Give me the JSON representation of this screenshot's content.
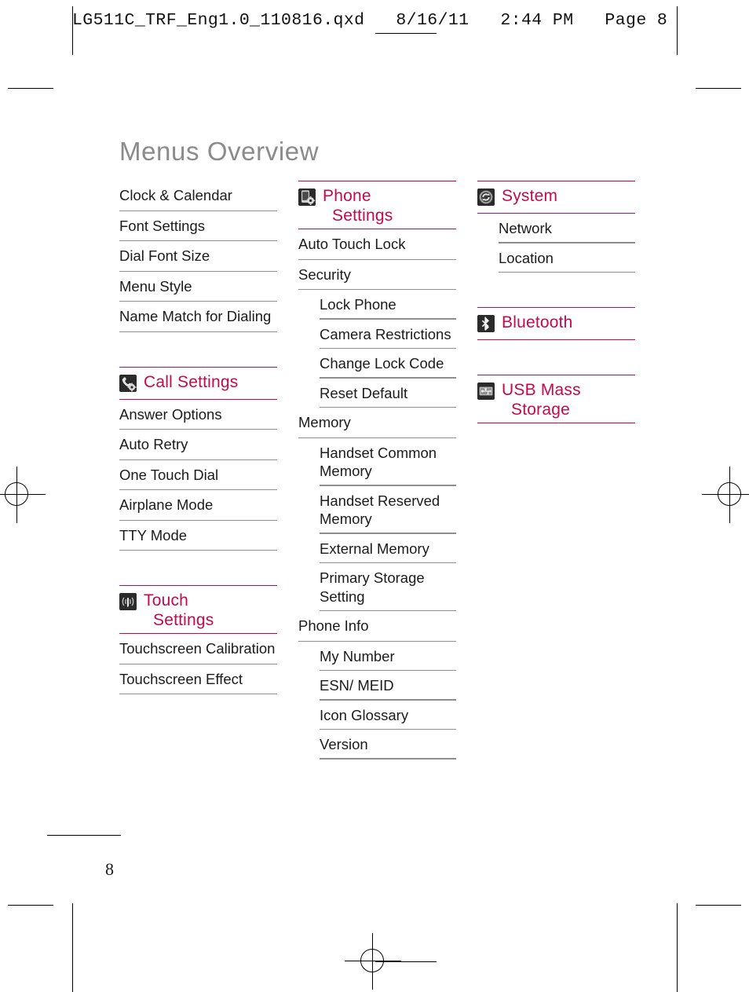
{
  "prepress": {
    "header_text": "LG511C_TRF_Eng1.0_110816.qxd   8/16/11   2:44 PM   Page 8",
    "page_number": "8"
  },
  "colors": {
    "accent": "#c20a4d",
    "title_gray": "#8b8b8b",
    "rule_gray": "#8e8e8e",
    "text": "#1b1b1b",
    "icon_bg": "#2b2b2b"
  },
  "page_title": "Menus Overview",
  "columns": [
    {
      "id": "column-left",
      "groups": [
        {
          "id": "group-display-settings",
          "header": null,
          "items": [
            {
              "label": "Clock & Calendar",
              "level": 0
            },
            {
              "label": "Font Settings",
              "level": 0
            },
            {
              "label": "Dial Font Size",
              "level": 0
            },
            {
              "label": "Menu Style",
              "level": 0
            },
            {
              "label": "Name Match for Dialing",
              "level": 0
            }
          ]
        },
        {
          "id": "group-call-settings",
          "header": {
            "line1": "Call Settings",
            "line2": "",
            "icon": "phone-gear-icon"
          },
          "items": [
            {
              "label": "Answer Options",
              "level": 0
            },
            {
              "label": "Auto Retry",
              "level": 0
            },
            {
              "label": "One Touch Dial",
              "level": 0
            },
            {
              "label": "Airplane Mode",
              "level": 0
            },
            {
              "label": "TTY Mode",
              "level": 0
            }
          ]
        },
        {
          "id": "group-touch-settings",
          "header": {
            "line1": "Touch",
            "line2": "Settings",
            "icon": "touch-ripple-icon"
          },
          "items": [
            {
              "label": "Touchscreen Calibration",
              "level": 0
            },
            {
              "label": "Touchscreen Effect",
              "level": 0
            }
          ]
        }
      ]
    },
    {
      "id": "column-middle",
      "groups": [
        {
          "id": "group-phone-settings",
          "header": {
            "line1": "Phone",
            "line2": "Settings",
            "icon": "phone-settings-icon"
          },
          "items": [
            {
              "label": "Auto Touch Lock",
              "level": 0
            },
            {
              "label": "Security",
              "level": 0
            },
            {
              "label": "Lock Phone",
              "level": 1
            },
            {
              "label": "Camera Restrictions",
              "level": 1
            },
            {
              "label": "Change Lock Code",
              "level": 1
            },
            {
              "label": "Reset Default",
              "level": 1
            },
            {
              "label": "Memory",
              "level": 0
            },
            {
              "label": "Handset Common Memory",
              "level": 1
            },
            {
              "label": "Handset Reserved Memory",
              "level": 1
            },
            {
              "label": "External Memory",
              "level": 1
            },
            {
              "label": "Primary Storage Setting",
              "level": 1
            },
            {
              "label": "Phone Info",
              "level": 0
            },
            {
              "label": "My Number",
              "level": 1
            },
            {
              "label": "ESN/ MEID",
              "level": 1
            },
            {
              "label": "Icon Glossary",
              "level": 1
            },
            {
              "label": "Version",
              "level": 1
            }
          ]
        }
      ]
    },
    {
      "id": "column-right",
      "groups": [
        {
          "id": "group-system",
          "header": {
            "line1": "System",
            "line2": "",
            "icon": "system-refresh-icon"
          },
          "items": [
            {
              "label": "Network",
              "level": 1
            },
            {
              "label": "Location",
              "level": 1
            }
          ]
        },
        {
          "id": "group-bluetooth",
          "header": {
            "line1": "Bluetooth",
            "line2": "",
            "icon": "bluetooth-icon"
          },
          "items": []
        },
        {
          "id": "group-usb-mass-storage",
          "header": {
            "line1": "USB Mass",
            "line2": "Storage",
            "icon": "usb-icon"
          },
          "items": []
        }
      ]
    }
  ]
}
